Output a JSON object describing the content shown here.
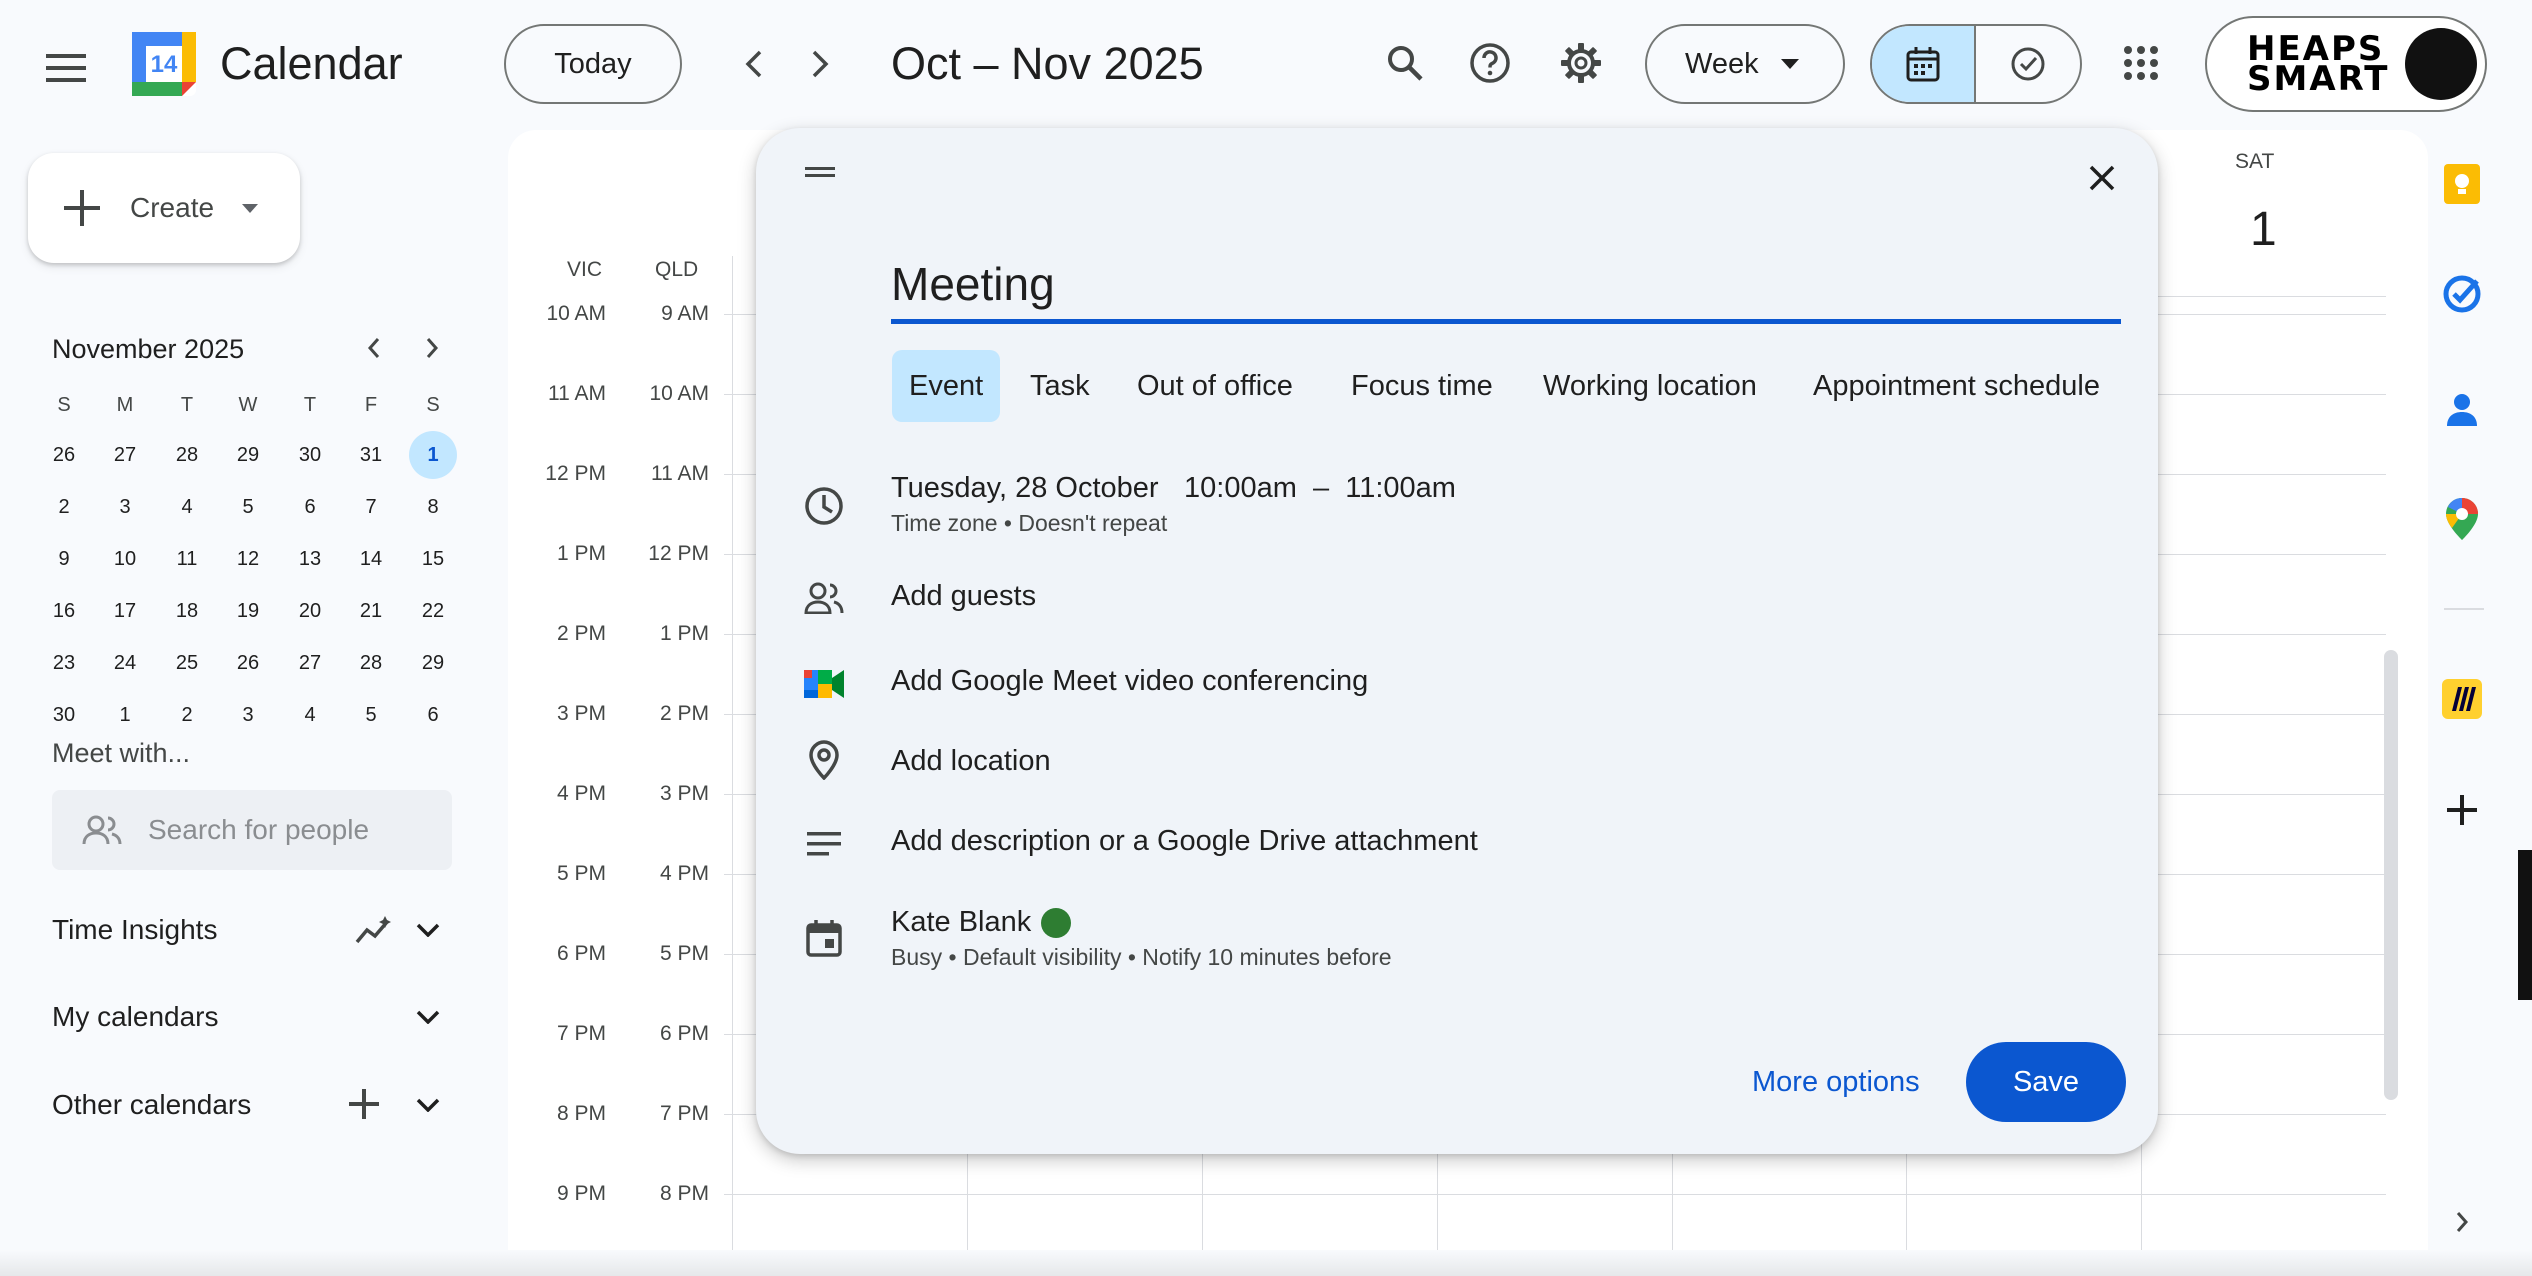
{
  "header": {
    "app_title": "Calendar",
    "logo_day": "14",
    "today_label": "Today",
    "range_title": "Oct – Nov 2025",
    "view_label": "Week",
    "account_logo_line1": "HEAPS",
    "account_logo_line2": "SMART"
  },
  "sidebar": {
    "create_label": "Create",
    "mini_calendar": {
      "title": "November 2025",
      "weekday_headers": [
        "S",
        "M",
        "T",
        "W",
        "T",
        "F",
        "S"
      ],
      "weeks": [
        [
          "26",
          "27",
          "28",
          "29",
          "30",
          "31",
          "1"
        ],
        [
          "2",
          "3",
          "4",
          "5",
          "6",
          "7",
          "8"
        ],
        [
          "9",
          "10",
          "11",
          "12",
          "13",
          "14",
          "15"
        ],
        [
          "16",
          "17",
          "18",
          "19",
          "20",
          "21",
          "22"
        ],
        [
          "23",
          "24",
          "25",
          "26",
          "27",
          "28",
          "29"
        ],
        [
          "30",
          "1",
          "2",
          "3",
          "4",
          "5",
          "6"
        ]
      ],
      "today": "1"
    },
    "meet_with": "Meet with...",
    "search_people_placeholder": "Search for people",
    "time_insights": "Time Insights",
    "my_calendars": "My calendars",
    "other_calendars": "Other calendars"
  },
  "grid": {
    "timezones": [
      "VIC",
      "QLD"
    ],
    "times_vic": [
      "10 AM",
      "11 AM",
      "12 PM",
      "1 PM",
      "2 PM",
      "3 PM",
      "4 PM",
      "5 PM",
      "6 PM",
      "7 PM",
      "8 PM",
      "9 PM"
    ],
    "times_qld": [
      "9 AM",
      "10 AM",
      "11 AM",
      "12 PM",
      "1 PM",
      "2 PM",
      "3 PM",
      "4 PM",
      "5 PM",
      "6 PM",
      "7 PM",
      "8 PM"
    ],
    "visible_day": {
      "weekday": "SAT",
      "date": "1"
    }
  },
  "dialog": {
    "title_value": "Meeting",
    "tabs": [
      "Event",
      "Task",
      "Out of office",
      "Focus time",
      "Working location",
      "Appointment schedule"
    ],
    "active_tab": "Event",
    "date": "Tuesday, 28 October",
    "time_range": "10:00am  –  11:00am",
    "time_sub": "Time zone • Doesn't repeat",
    "add_guests": "Add guests",
    "add_meet": "Add Google Meet video conferencing",
    "add_location": "Add location",
    "add_description": "Add description or a Google Drive attachment",
    "calendar_owner": "Kate Blank",
    "calendar_color": "#2e7d32",
    "calendar_sub": "Busy • Default visibility • Notify 10 minutes before",
    "more_options": "More options",
    "save": "Save"
  },
  "colors": {
    "accent": "#0b57d0",
    "selected_bg": "#c2e7ff",
    "background": "#f8fafd"
  }
}
